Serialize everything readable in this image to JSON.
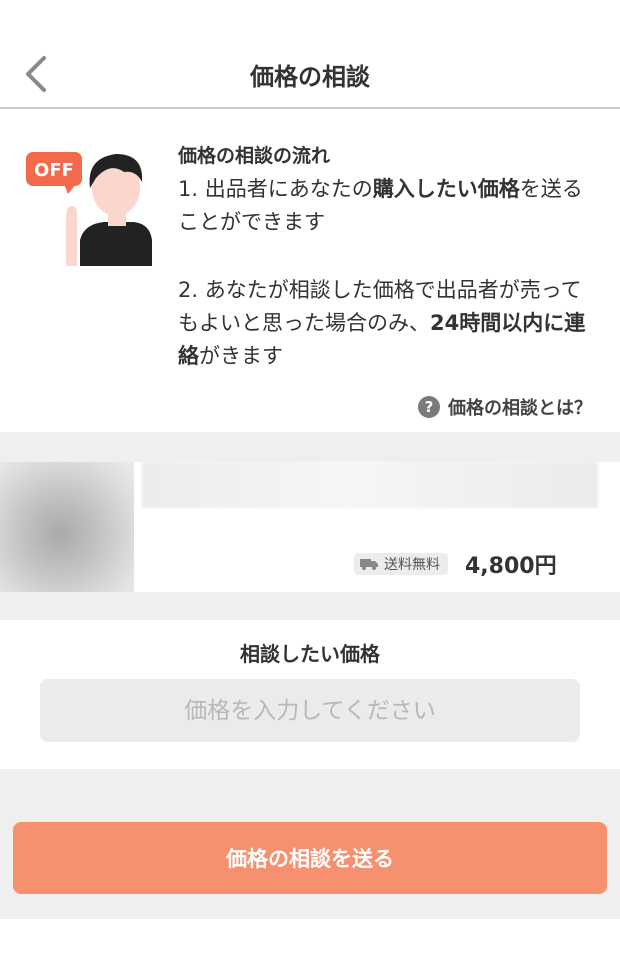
{
  "header": {
    "title": "価格の相談"
  },
  "flow": {
    "title": "価格の相談の流れ",
    "step1": {
      "pre": "1. 出品者にあなたの",
      "bold": "購入したい価格",
      "post": "を送ることができます"
    },
    "step2": {
      "pre": "2. あなたが相談した価格で出品者が売ってもよいと思った場合のみ、",
      "bold": "24時間以内に連絡",
      "post": "がきます"
    },
    "help_link": "価格の相談とは？",
    "illustration_badge": "OFF"
  },
  "product": {
    "shipping": "送料無料",
    "price": "4,800円"
  },
  "form": {
    "label": "相談したい価格",
    "placeholder": "価格を入力してください",
    "value": ""
  },
  "submit": {
    "label": "価格の相談を送る"
  },
  "colors": {
    "accent": "#f7906f",
    "badge": "#f26a4b",
    "background_gray": "#efefef"
  },
  "icons": [
    "chevron-left-icon",
    "question-icon",
    "truck-icon",
    "off-badge-icon"
  ]
}
